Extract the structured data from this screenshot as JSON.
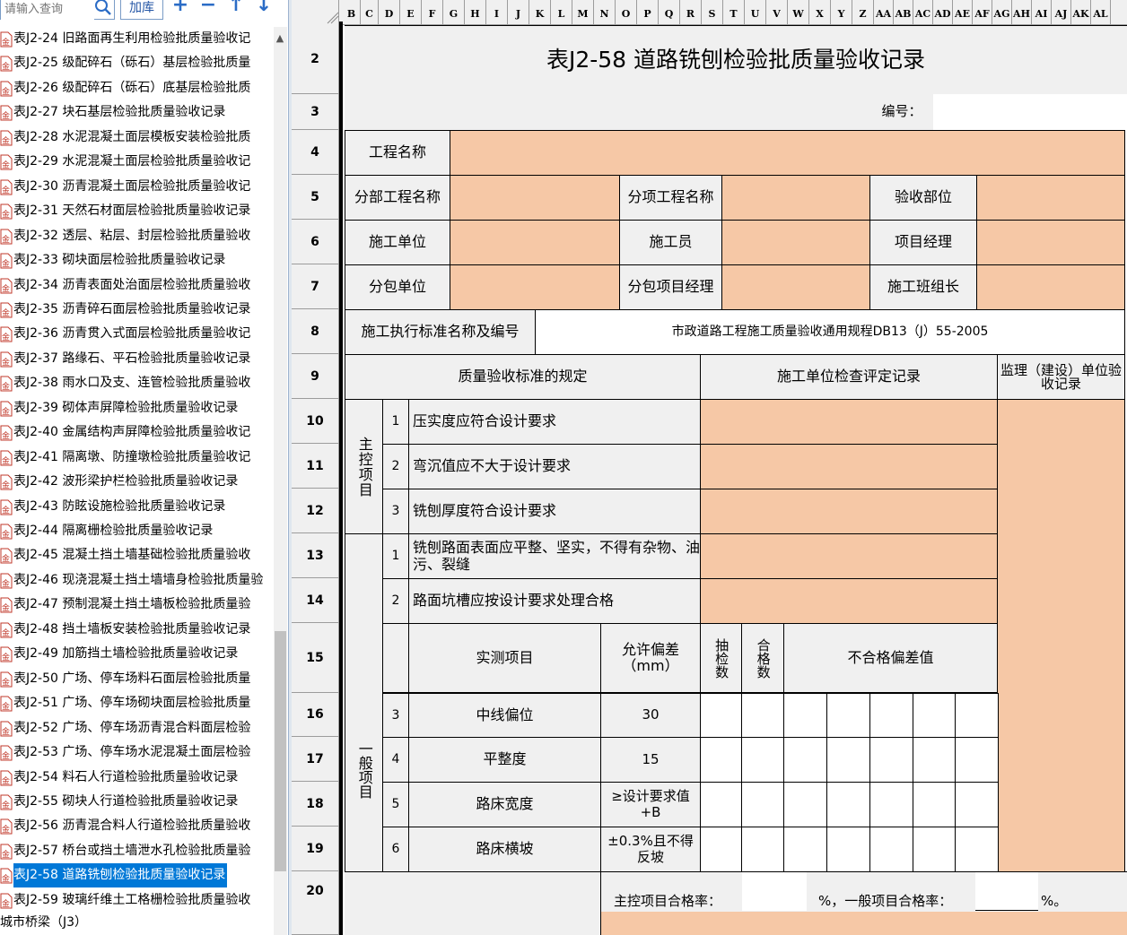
{
  "left_panel": {
    "search_placeholder": "请输入查询",
    "add_lib_label": "加库",
    "toolbar_icons": [
      "plus-icon",
      "minus-icon",
      "arrow-up-icon",
      "arrow-down-icon"
    ],
    "items": [
      "表J2-24 旧路面再生利用检验批质量验收记",
      "表J2-25 级配碎石（砾石）基层检验批质量",
      "表J2-26 级配碎石（砾石）底基层检验批质",
      "表J2-27 块石基层检验批质量验收记录",
      "表J2-28 水泥混凝土面层模板安装检验批质",
      "表J2-29 水泥混凝土面层检验批质量验收记",
      "表J2-30 沥青混凝土面层检验批质量验收记",
      "表J2-31 天然石材面层检验批质量验收记录",
      "表J2-32 透层、粘层、封层检验批质量验收",
      "表J2-33 砌块面层检验批质量验收记录",
      "表J2-34 沥青表面处治面层检验批质量验收",
      "表J2-35 沥青碎石面层检验批质量验收记录",
      "表J2-36 沥青贯入式面层检验批质量验收记",
      "表J2-37 路缘石、平石检验批质量验收记录",
      "表J2-38 雨水口及支、连管检验批质量验收",
      "表J2-39 砌体声屏障检验批质量验收记录",
      "表J2-40 金属结构声屏障检验批质量验收记",
      "表J2-41 隔离墩、防撞墩检验批质量验收记",
      "表J2-42 波形梁护栏检验批质量验收记录",
      "表J2-43 防眩设施检验批质量验收记录",
      "表J2-44 隔离栅检验批质量验收记录",
      "表J2-45 混凝土挡土墙基础检验批质量验收",
      "表J2-46 现浇混凝土挡土墙墙身检验批质量验",
      "表J2-47 预制混凝土挡土墙板检验批质量验",
      "表J2-48 挡土墙板安装检验批质量验收记录",
      "表J2-49 加筋挡土墙检验批质量验收记录",
      "表J2-50 广场、停车场料石面层检验批质量",
      "表J2-51 广场、停车场砌块面层检验批质量",
      "表J2-52 广场、停车场沥青混合料面层检验",
      "表J2-53 广场、停车场水泥混凝土面层检验",
      "表J2-54 料石人行道检验批质量验收记录",
      "表J2-55 砌块人行道检验批质量验收记录",
      "表J2-56 沥青混合料人行道检验批质量验收",
      "表J2-57 桥台或挡土墙泄水孔检验批质量验",
      "表J2-58 道路铣刨检验批质量验收记录",
      "表J2-59 玻璃纤维土工格栅检验批质量验收"
    ],
    "selected_index": 34,
    "tree_next": "城市桥梁（J3）"
  },
  "sheet": {
    "columns": [
      "B",
      "C",
      "D",
      "E",
      "F",
      "G",
      "H",
      "I",
      "J",
      "K",
      "L",
      "M",
      "N",
      "O",
      "P",
      "Q",
      "R",
      "S",
      "T",
      "U",
      "V",
      "W",
      "X",
      "Y",
      "Z",
      "AA",
      "AB",
      "AC",
      "AD",
      "AE",
      "AF",
      "AG",
      "AH",
      "AI",
      "AJ",
      "AK",
      "AL"
    ],
    "rows": [
      "2",
      "3",
      "4",
      "5",
      "6",
      "7",
      "8",
      "9",
      "10",
      "11",
      "12",
      "13",
      "14",
      "15",
      "16",
      "17",
      "18",
      "19",
      "20"
    ],
    "title": "表J2-58 道路铣刨检验批质量验收记录",
    "number_label": "编号：",
    "project_name": "工程名称",
    "division_name": "分部工程名称",
    "subitem_name": "分项工程名称",
    "accept_part": "验收部位",
    "constructor": "施工单位",
    "worker": "施工员",
    "pm": "项目经理",
    "subcontractor": "分包单位",
    "sub_pm": "分包项目经理",
    "team_leader": "施工班组长",
    "std_label": "施工执行标准名称及编号",
    "std_value": "市政道路工程施工质量验收通用规程DB13（J）55-2005",
    "h_quality": "质量验收标准的规定",
    "h_check": "施工单位检查评定记录",
    "h_supervisor": "监理（建设）单位验收记录",
    "main_items_label": "主控项目",
    "main_items": [
      {
        "no": "1",
        "text": "压实度应符合设计要求"
      },
      {
        "no": "2",
        "text": "弯沉值应不大于设计要求"
      },
      {
        "no": "3",
        "text": "铣刨厚度符合设计要求"
      }
    ],
    "general_label": "一般项目",
    "general_items": [
      {
        "no": "1",
        "text": "铣刨路面表面应平整、坚实，不得有杂物、油污、裂缝"
      },
      {
        "no": "2",
        "text": "路面坑槽应按设计要求处理合格"
      }
    ],
    "measure_header": {
      "item": "实测项目",
      "tol": "允许偏差（mm）",
      "sample": "抽检数",
      "pass": "合格数",
      "fail": "不合格偏差值"
    },
    "measures": [
      {
        "no": "3",
        "item": "中线偏位",
        "tol": "30"
      },
      {
        "no": "4",
        "item": "平整度",
        "tol": "15"
      },
      {
        "no": "5",
        "item": "路床宽度",
        "tol": "≥设计要求值+B"
      },
      {
        "no": "6",
        "item": "路床横坡",
        "tol": "±0.3%且不得反坡"
      }
    ],
    "rate_label1": "主控项目合格率：",
    "rate_label2": "%，一般项目合格率：",
    "rate_suffix": "%。"
  },
  "colors": {
    "orange": "#f6c8a6",
    "gray": "#f0f0f0",
    "select": "#0078d7"
  }
}
